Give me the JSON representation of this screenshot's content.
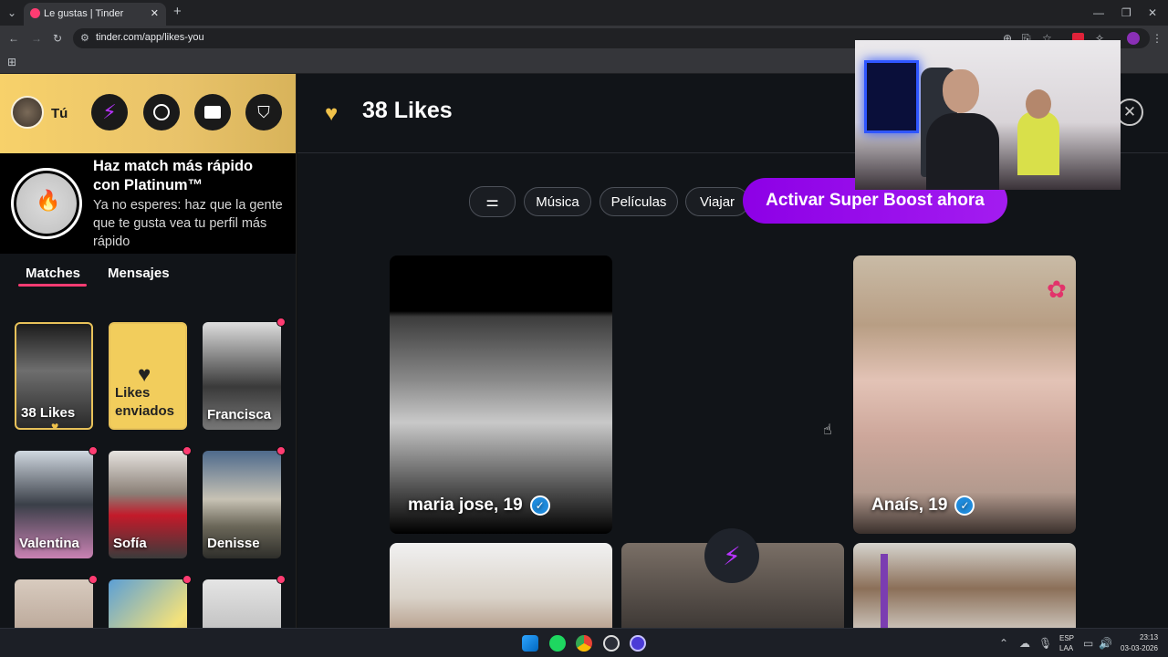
{
  "browser": {
    "tab_title": "Le gustas | Tinder",
    "url": "tinder.com/app/likes-you",
    "new_tab": "+",
    "close_tab": "✕"
  },
  "sidebar": {
    "user_label": "Tú",
    "promo": {
      "title": "Haz match más rápido con Platinum™",
      "subtitle": "Ya no esperes: haz que la gente que te gusta vea tu perfil más rápido"
    },
    "tabs": [
      "Matches",
      "Mensajes"
    ],
    "cards": [
      {
        "label": "38 Likes"
      },
      {
        "label": "Likes enviados"
      },
      {
        "label": "Francisca"
      },
      {
        "label": "Valentina"
      },
      {
        "label": "Sofía"
      },
      {
        "label": "Denisse"
      },
      {
        "label": ""
      },
      {
        "label": ""
      },
      {
        "label": ""
      }
    ]
  },
  "main": {
    "likes_title": "38 Likes",
    "chips": [
      "Música",
      "Películas",
      "Viajar"
    ],
    "boost_button": "Activar Super Boost ahora",
    "profiles": [
      {
        "name": "maria jose, 19"
      },
      {
        "name": "Anaís, 19"
      }
    ]
  },
  "taskbar": {
    "lang_top": "ESP",
    "lang_bottom": "LAA",
    "time": "23:13",
    "date": "03-03-2026"
  },
  "colors": {
    "brand_pink": "#fe3c72",
    "gold": "#f7d16a",
    "boost_purple": "#9b0ff0",
    "verified_blue": "#1f8bdc"
  }
}
